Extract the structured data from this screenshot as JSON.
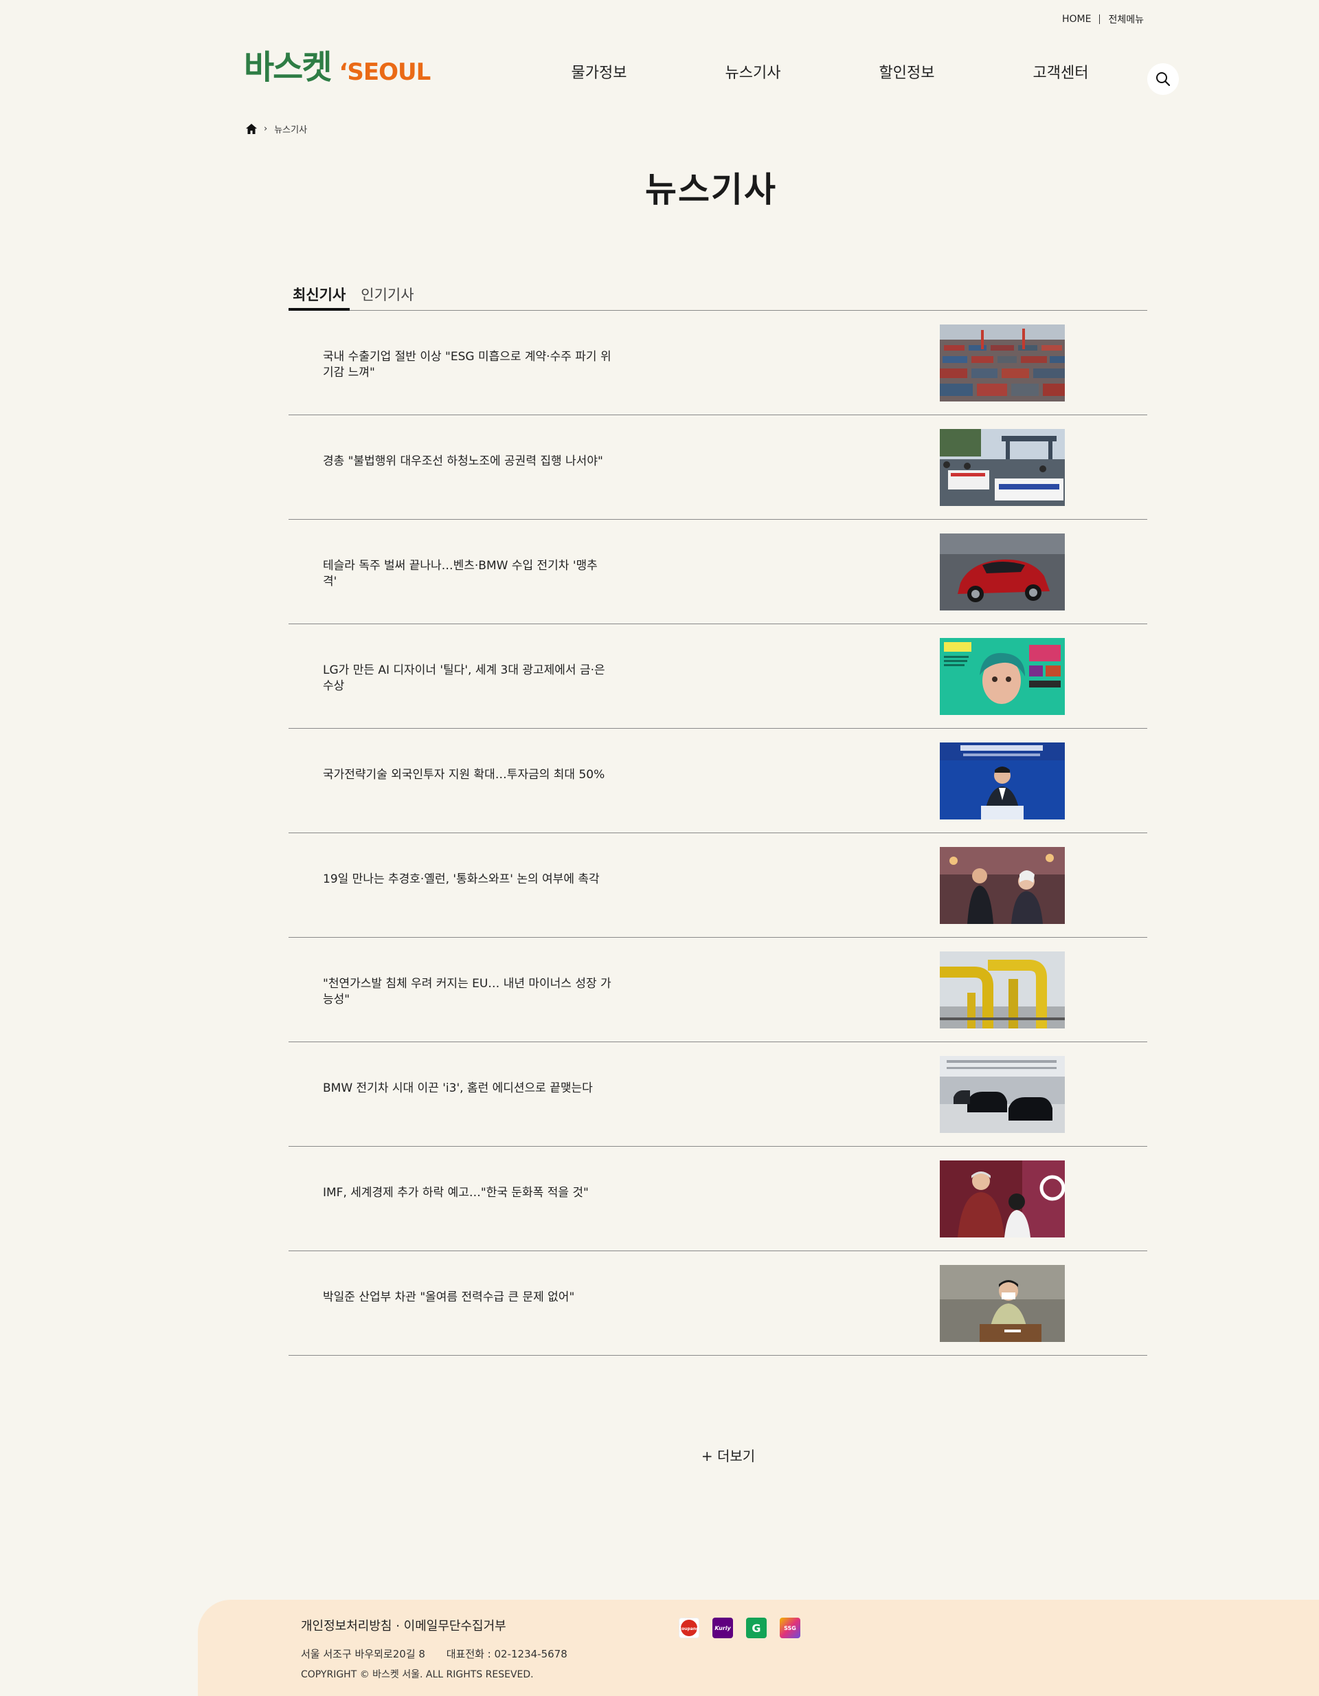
{
  "util": {
    "home": "HOME",
    "all_menu": "전체메뉴"
  },
  "logo": {
    "ko": "바스켓",
    "en": "‘SEOUL"
  },
  "nav": [
    "물가정보",
    "뉴스기사",
    "할인정보",
    "고객센터"
  ],
  "breadcrumb": {
    "current": "뉴스기사"
  },
  "page": {
    "title": "뉴스기사"
  },
  "tabs": [
    "최신기사",
    "인기기사"
  ],
  "articles": [
    {
      "title": "국내 수출기업 절반 이상 \"ESG 미흡으로 계약·수주 파기 위기감 느껴\""
    },
    {
      "title": "경총 \"불법행위 대우조선 하청노조에 공권력 집행 나서야\""
    },
    {
      "title": "테슬라 독주 벌써 끝나나…벤츠·BMW 수입 전기차 '맹추격'"
    },
    {
      "title": "LG가 만든 AI 디자이너 '틸다', 세계 3대 광고제에서 금·은 수상"
    },
    {
      "title": "국가전략기술 외국인투자 지원 확대…투자금의 최대 50%"
    },
    {
      "title": "19일 만나는 추경호·옐런, '통화스와프' 논의 여부에 촉각"
    },
    {
      "title": "\"천연가스발 침체 우려 커지는 EU… 내년 마이너스 성장 가능성\""
    },
    {
      "title": "BMW 전기차 시대 이끈 'i3', 홈런 에디션으로 끝맺는다"
    },
    {
      "title": "IMF, 세계경제 추가 하락 예고…\"한국 둔화폭 적을 것\""
    },
    {
      "title": "박일준 산업부 차관 \"올여름 전력수급 큰 문제 없어\""
    }
  ],
  "more": "+ 더보기",
  "footer": {
    "links": "개인정보처리방침 · 이메일무단수집거부",
    "address": "서울 서조구 바우뫼로20길 8",
    "phone": "대표전화 : 02-1234-5678",
    "copyright": "COPYRIGHT © 바스켓 서울. ALL RIGHTS RESEVED."
  },
  "partners": [
    {
      "icon": "coupang-logo-icon",
      "color": "#d82a1f",
      "label": "coupang"
    },
    {
      "icon": "kurly-logo-icon",
      "color": "#5f0080",
      "label": "Kurly"
    },
    {
      "icon": "g-market-logo-icon",
      "color": "#13a356",
      "label": "G"
    },
    {
      "icon": "ssg-logo-icon",
      "color": "#e0337a",
      "label": "SSG"
    }
  ]
}
